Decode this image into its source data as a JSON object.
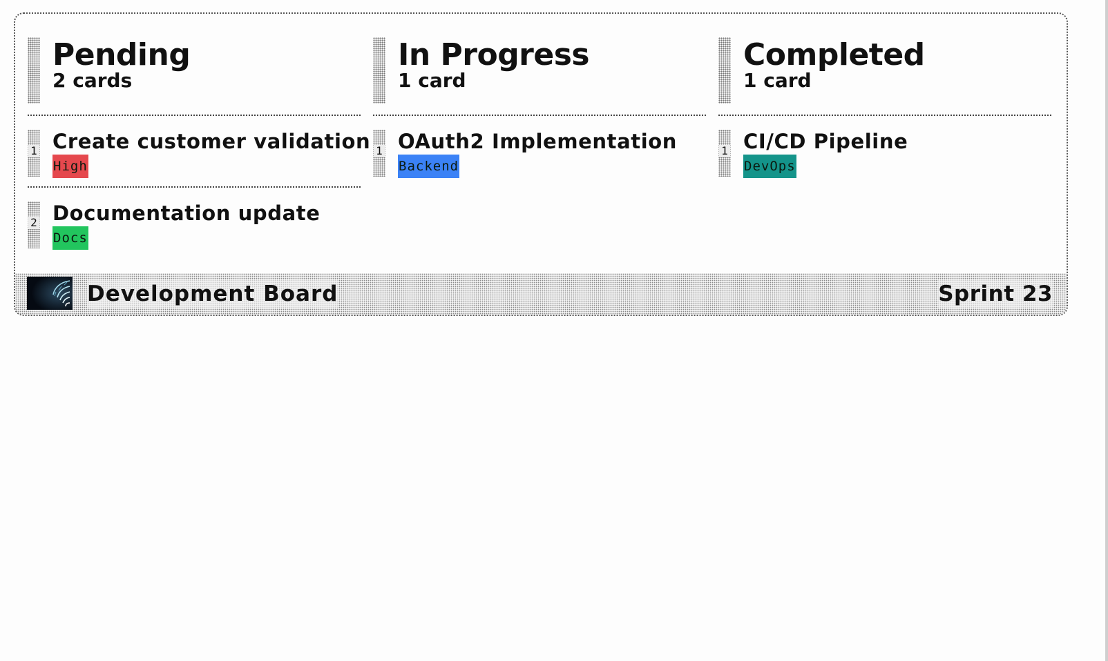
{
  "board": {
    "columns": [
      {
        "title": "Pending",
        "count": "2 cards",
        "cards": [
          {
            "index": "1",
            "title": "Create customer validation",
            "tag": "High",
            "tag_color": "#e5484d"
          },
          {
            "index": "2",
            "title": "Documentation update",
            "tag": "Docs",
            "tag_color": "#22c55e"
          }
        ]
      },
      {
        "title": "In Progress",
        "count": "1 card",
        "cards": [
          {
            "index": "1",
            "title": "OAuth2 Implementation",
            "tag": "Backend",
            "tag_color": "#3b82f6"
          }
        ]
      },
      {
        "title": "Completed",
        "count": "1 card",
        "cards": [
          {
            "index": "1",
            "title": "CI/CD Pipeline",
            "tag": "DevOps",
            "tag_color": "#14948a"
          }
        ]
      }
    ]
  },
  "footer": {
    "logo_icon": "spiral-logo-icon",
    "title": "Development Board",
    "sprint": "Sprint 23"
  }
}
